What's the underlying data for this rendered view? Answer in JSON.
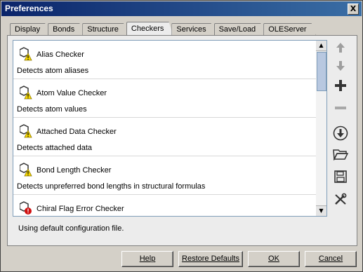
{
  "window": {
    "title": "Preferences",
    "close_glyph": "X"
  },
  "tabs": [
    {
      "label": "Display"
    },
    {
      "label": "Bonds"
    },
    {
      "label": "Structure"
    },
    {
      "label": "Checkers"
    },
    {
      "label": "Services"
    },
    {
      "label": "Save/Load"
    },
    {
      "label": "OLEServer"
    }
  ],
  "active_tab": "Checkers",
  "checkers": [
    {
      "name": "Alias Checker",
      "description": "Detects atom aliases",
      "icon": "checker-warning-icon"
    },
    {
      "name": "Atom Value Checker",
      "description": "Detects atom values",
      "icon": "checker-warning-icon"
    },
    {
      "name": "Attached Data Checker",
      "description": "Detects attached data",
      "icon": "checker-warning-icon"
    },
    {
      "name": "Bond Length Checker",
      "description": "Detects unpreferred bond lengths in structural formulas",
      "icon": "checker-warning-icon"
    },
    {
      "name": "Chiral Flag Error Checker",
      "description": "",
      "icon": "checker-error-icon"
    }
  ],
  "side_tools": [
    {
      "icon": "arrow-up-icon",
      "enabled": false
    },
    {
      "icon": "arrow-down-icon",
      "enabled": false
    },
    {
      "icon": "add-icon",
      "enabled": true
    },
    {
      "icon": "remove-icon",
      "enabled": false
    },
    {
      "icon": "download-icon",
      "enabled": true
    },
    {
      "icon": "folder-open-icon",
      "enabled": true
    },
    {
      "icon": "save-icon",
      "enabled": true
    },
    {
      "icon": "tools-icon",
      "enabled": true
    }
  ],
  "status_text": "Using default configuration file.",
  "buttons": {
    "help": "Help",
    "restore": "Restore Defaults",
    "ok": "OK",
    "cancel": "Cancel"
  }
}
